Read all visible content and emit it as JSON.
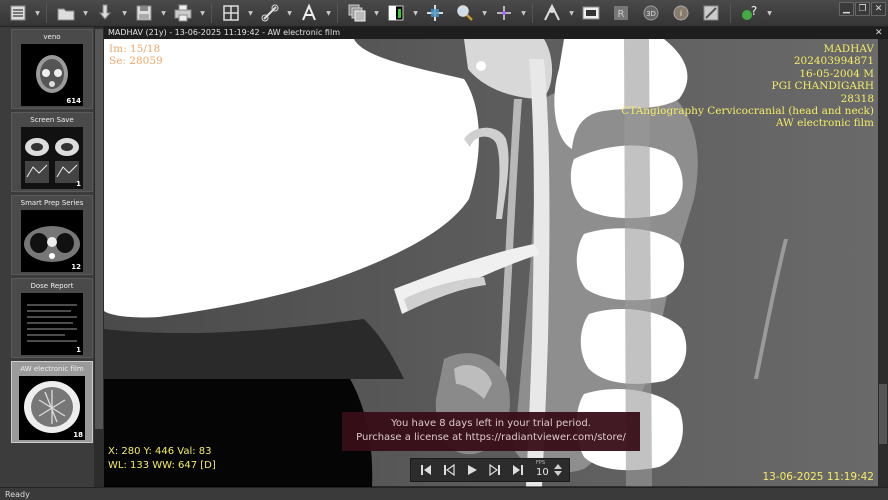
{
  "toolbar": {
    "buttons": [
      "menu-icon",
      "open-folder-icon",
      "download-icon",
      "save-icon",
      "print-icon",
      "layout-grid-icon",
      "measure-link-icon",
      "text-annotation-icon",
      "series-stack-icon",
      "window-level-icon",
      "pan-crosshair-icon",
      "zoom-magnifier-icon",
      "crosshair-reference-icon",
      "mpr-3d-icon",
      "film-print-icon",
      "dicom-anonymize-icon",
      "3d-volume-icon",
      "dicom-info-icon",
      "image-tool-icon",
      "plugin-help-icon"
    ]
  },
  "series": [
    {
      "title": "veno",
      "count": "614",
      "active": false
    },
    {
      "title": "Screen Save",
      "count": "1",
      "active": false
    },
    {
      "title": "Smart Prep Series",
      "count": "12",
      "active": false
    },
    {
      "title": "Dose Report",
      "count": "1",
      "active": false
    },
    {
      "title": "AW electronic film",
      "count": "18",
      "active": true
    }
  ],
  "viewer": {
    "title": "MADHAV  (21y) - 13-06-2025 11:19:42 - AW electronic film",
    "overlay_top_left": [
      "Im: 15/18",
      "Se: 28059"
    ],
    "overlay_top_right": [
      "MADHAV",
      "202403994871",
      "16-05-2004 M",
      "PGI CHANDIGARH",
      "28318",
      "CTAngiography Cervicocranial (head and neck)",
      "AW electronic film"
    ],
    "overlay_bottom_left": [
      "X: 280 Y: 446 Val: 83",
      "WL: 133 WW: 647 [D]"
    ],
    "overlay_bottom_right": "13-06-2025 11:19:42",
    "trial_message": [
      "You have 8 days left in your trial period.",
      "Purchase a license at https://radiantviewer.com/store/"
    ]
  },
  "cine": {
    "fps_label": "FPS",
    "fps_value": "10"
  },
  "status": {
    "text": "Ready"
  },
  "colors": {
    "overlay_yellow": "#f5ec66",
    "overlay_orange": "#f0a76a",
    "trial_bg": "#380e18"
  }
}
